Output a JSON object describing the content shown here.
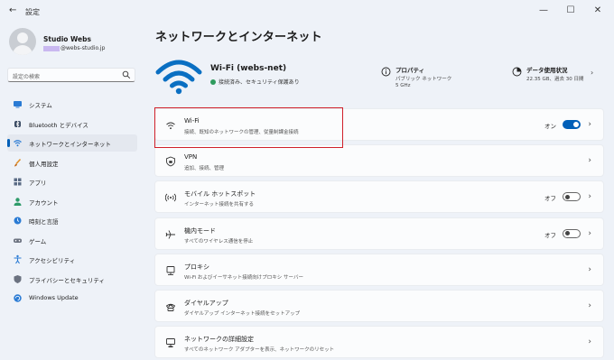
{
  "window": {
    "title": "設定",
    "back_icon": "back-arrow-icon",
    "minimize": "—",
    "maximize": "☐",
    "close": "✕"
  },
  "user": {
    "name": "Studio Webs",
    "email": "@webs-studio.jp"
  },
  "search": {
    "placeholder": "設定の検索"
  },
  "sidebar": {
    "items": [
      {
        "label": "システム",
        "icon": "display-icon",
        "active": false
      },
      {
        "label": "Bluetooth とデバイス",
        "icon": "bluetooth-icon",
        "active": false
      },
      {
        "label": "ネットワークとインターネット",
        "icon": "wifi-icon",
        "active": true
      },
      {
        "label": "個人用設定",
        "icon": "brush-icon",
        "active": false
      },
      {
        "label": "アプリ",
        "icon": "apps-icon",
        "active": false
      },
      {
        "label": "アカウント",
        "icon": "person-icon",
        "active": false
      },
      {
        "label": "時刻と言語",
        "icon": "globe-clock-icon",
        "active": false
      },
      {
        "label": "ゲーム",
        "icon": "gamepad-icon",
        "active": false
      },
      {
        "label": "アクセシビリティ",
        "icon": "accessibility-icon",
        "active": false
      },
      {
        "label": "プライバシーとセキュリティ",
        "icon": "shield-icon",
        "active": false
      },
      {
        "label": "Windows Update",
        "icon": "update-icon",
        "active": false
      }
    ]
  },
  "main": {
    "title": "ネットワークとインターネット",
    "network": {
      "name": "Wi-Fi (webs-net)",
      "status": "接続済み、セキュリティ保護あり"
    },
    "properties": {
      "title": "プロパティ",
      "line1": "パブリック ネットワーク",
      "line2": "5 GHz"
    },
    "data_usage": {
      "title": "データ使用状況",
      "line1": "22.35 GB、過去 30 日間"
    },
    "rows": [
      {
        "title": "Wi-Fi",
        "sub": "接続、既知のネットワークの管理、従量制課金接続",
        "icon": "wifi-icon",
        "toggle": "on",
        "toggle_label": "オン"
      },
      {
        "title": "VPN",
        "sub": "追加、接続、管理",
        "icon": "vpn-shield-icon",
        "toggle": null,
        "toggle_label": ""
      },
      {
        "title": "モバイル ホットスポット",
        "sub": "インターネット接続を共有する",
        "icon": "hotspot-icon",
        "toggle": "off",
        "toggle_label": "オフ"
      },
      {
        "title": "機内モード",
        "sub": "すべてのワイヤレス通信を停止",
        "icon": "airplane-icon",
        "toggle": "off",
        "toggle_label": "オフ"
      },
      {
        "title": "プロキシ",
        "sub": "Wi-Fi およびイーサネット接続向けプロキシ サーバー",
        "icon": "proxy-icon",
        "toggle": null,
        "toggle_label": ""
      },
      {
        "title": "ダイヤルアップ",
        "sub": "ダイヤルアップ インターネット接続をセットアップ",
        "icon": "dialup-icon",
        "toggle": null,
        "toggle_label": ""
      },
      {
        "title": "ネットワークの詳細設定",
        "sub": "すべてのネットワーク アダプターを表示、ネットワークのリセット",
        "icon": "network-advanced-icon",
        "toggle": null,
        "toggle_label": ""
      }
    ]
  },
  "colors": {
    "accent": "#005fb8",
    "highlight_box": "#d0202a",
    "background": "#eef2f8"
  }
}
